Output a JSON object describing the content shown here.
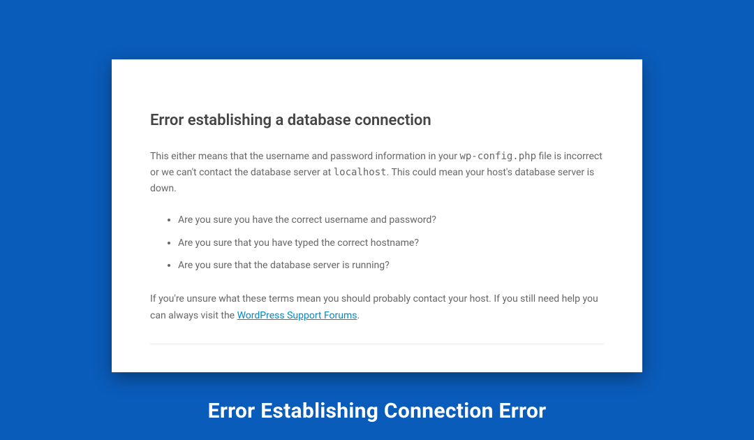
{
  "card": {
    "heading": "Error establishing a database connection",
    "intro_part1": "This either means that the username and password information in your ",
    "intro_code1": "wp-config.php",
    "intro_part2": " file is incorrect or we can't contact the database server at ",
    "intro_code2": "localhost",
    "intro_part3": ". This could mean your host's database server is down.",
    "list": {
      "item1": "Are you sure you have the correct username and password?",
      "item2": "Are you sure that you have typed the correct hostname?",
      "item3": "Are you sure that the database server is running?"
    },
    "footer_part1": "If you're unsure what these terms mean you should probably contact your host. If you still need help you can always visit the ",
    "footer_link": "WordPress Support Forums",
    "footer_part2": "."
  },
  "caption": "Error Establishing Connection Error"
}
